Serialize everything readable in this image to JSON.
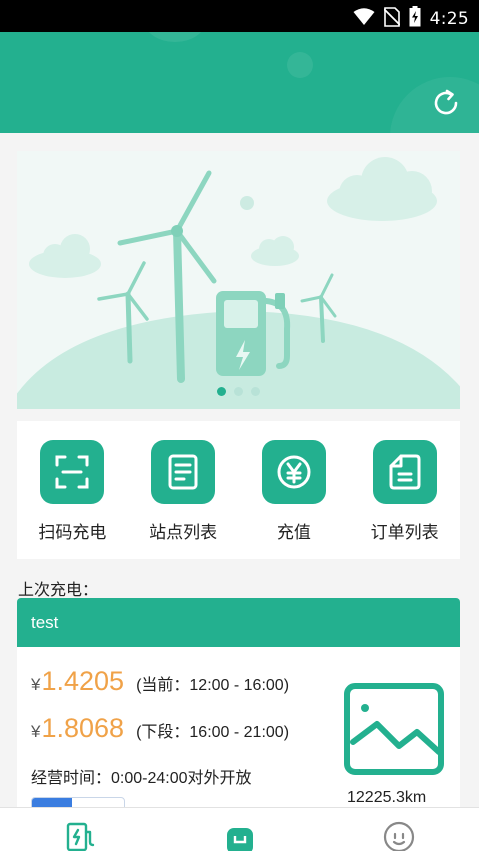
{
  "statusbar": {
    "time": "4:25",
    "icons": [
      "wifi-icon",
      "no-sim-icon",
      "battery-charging-icon"
    ]
  },
  "header": {
    "refresh_icon": "refresh-icon"
  },
  "banner": {
    "illustration": "wind-turbine-charging-station",
    "slide_count": 3,
    "active_slide": 1
  },
  "shortcuts": [
    {
      "label": "扫码充电",
      "icon": "scan-icon"
    },
    {
      "label": "站点列表",
      "icon": "list-document-icon"
    },
    {
      "label": "充值",
      "icon": "yuan-coin-icon"
    },
    {
      "label": "订单列表",
      "icon": "order-document-icon"
    }
  ],
  "last_charge": {
    "title": "上次充电：",
    "station_name": "test",
    "current_price": {
      "currency": "¥",
      "amount": "1.4205",
      "period": "(当前：12:00 - 16:00)"
    },
    "next_price": {
      "currency": "¥",
      "amount": "1.8068",
      "period": "(下段：16:00 - 21:00)"
    },
    "hours": "经营时间：0:00-24:00对外开放",
    "distance": "12225.3km",
    "thumbnail_icon": "image-placeholder-icon"
  },
  "tabbar": [
    {
      "icon": "charger-icon"
    },
    {
      "icon": "home-icon"
    },
    {
      "icon": "profile-icon"
    }
  ],
  "colors": {
    "brand": "#23b08f",
    "price": "#f0a248",
    "toggle_active": "#3a7de0"
  }
}
